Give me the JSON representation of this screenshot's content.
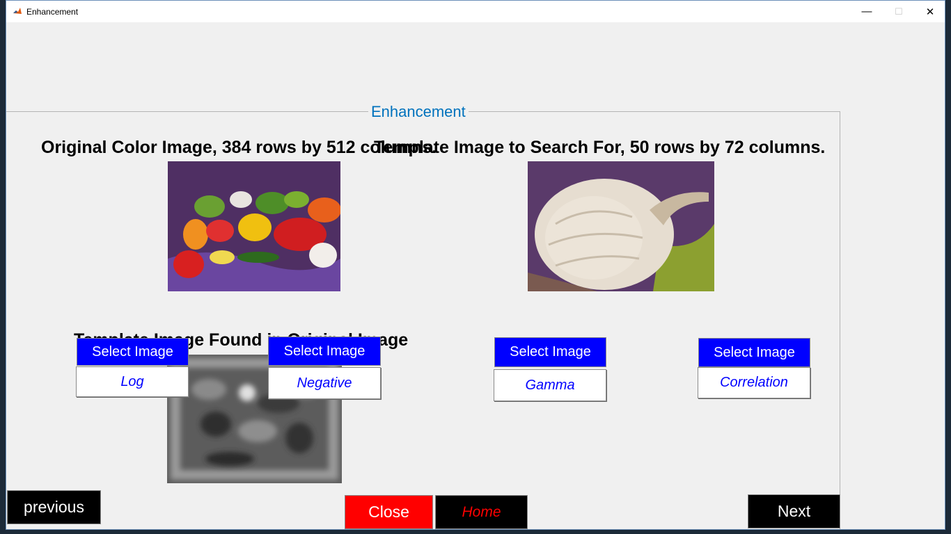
{
  "window": {
    "title": "Enhancement",
    "minimize_glyph": "—",
    "maximize_glyph": "☐",
    "close_glyph": "✕"
  },
  "panel": {
    "title": "Enhancement"
  },
  "captions": {
    "original": "Original Color Image, 384 rows by 512 columns.",
    "template": "Template Image to Search For, 50 rows by 72 columns.",
    "found": "Template Image Found in Original Image"
  },
  "buttons": {
    "select_image": "Select Image",
    "log": "Log",
    "negative": "Negative",
    "gamma": "Gamma",
    "correlation": "Correlation",
    "previous": "previous",
    "close": "Close",
    "home": "Home",
    "next": "Next"
  },
  "colors": {
    "accent": "#0072bd",
    "select_button": "#0000ff",
    "close_button": "#ff0000",
    "nav_button": "#000000"
  }
}
